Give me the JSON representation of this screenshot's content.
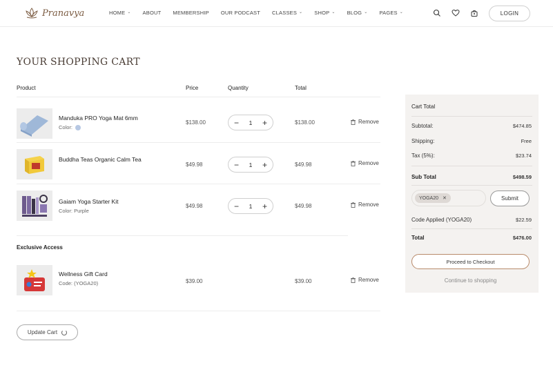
{
  "header": {
    "brand": "Pranavya",
    "nav": [
      {
        "label": "HOME",
        "dropdown": true
      },
      {
        "label": "ABOUT",
        "dropdown": false
      },
      {
        "label": "MEMBERSHIP",
        "dropdown": false
      },
      {
        "label": "OUR PODCAST",
        "dropdown": false
      },
      {
        "label": "CLASSES",
        "dropdown": true
      },
      {
        "label": "SHOP",
        "dropdown": true
      },
      {
        "label": "BLOG",
        "dropdown": true
      },
      {
        "label": "PAGES",
        "dropdown": true
      }
    ],
    "icons": [
      "search-icon",
      "heart-icon",
      "cart-icon"
    ],
    "login_label": "LOGIN"
  },
  "page_title": "YOUR SHOPPING CART",
  "table": {
    "headers": {
      "product": "Product",
      "price": "Price",
      "quantity": "Quantity",
      "total": "Total"
    },
    "items": [
      {
        "name": "Manduka PRO Yoga Mat 6mm",
        "sub": "Color:",
        "swatch": "#b7c8e3",
        "price": "$138.00",
        "qty": "1",
        "total": "$138.00",
        "remove": "Remove"
      },
      {
        "name": "Buddha Teas Organic Calm Tea",
        "sub": "",
        "price": "$49.98",
        "qty": "1",
        "total": "$49.98",
        "remove": "Remove"
      },
      {
        "name": "Gaiam Yoga Starter Kit",
        "sub": "Color: Purple",
        "price": "$49.98",
        "qty": "1",
        "total": "$49.98",
        "remove": "Remove"
      }
    ],
    "exclusive_label": "Exclusive Access",
    "gift": {
      "name": "Wellness Gift Card",
      "sub": "Code: (YOGA20)",
      "price": "$39.00",
      "total": "$39.00",
      "remove": "Remove"
    },
    "update_label": "Update Cart"
  },
  "cart_total": {
    "title": "Cart Total",
    "subtotal_label": "Subtotal:",
    "subtotal": "$474.85",
    "shipping_label": "Shipping:",
    "shipping": "Free",
    "tax_label": "Tax (5%):",
    "tax": "$23.74",
    "sub_total_label": "Sub Total",
    "sub_total": "$498.59",
    "coupon": "YOGA20",
    "submit_label": "Submit",
    "applied_label": "Code Applied (YOGA20)",
    "applied": "$22.59",
    "total_label": "Total",
    "total": "$476.00",
    "checkout_label": "Proceed to Checkout",
    "continue_label": "Continue to shopping"
  },
  "colors": {
    "accent": "#7a5a40",
    "sidebar_bg": "#f4f2f0",
    "checkout_border": "#b88a6a"
  }
}
